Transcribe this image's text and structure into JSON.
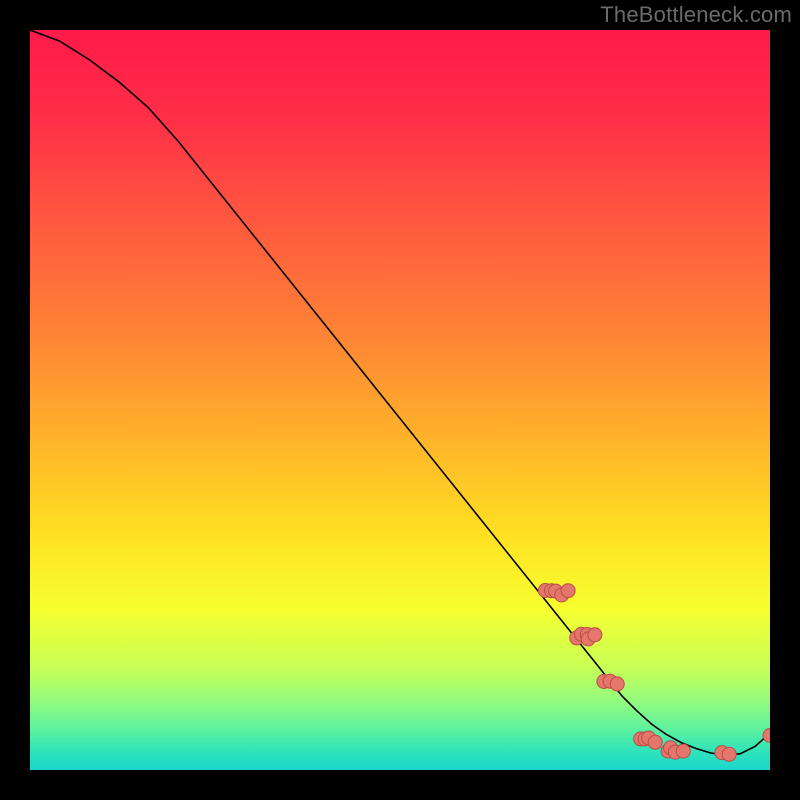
{
  "watermark": "TheBottleneck.com",
  "colors": {
    "line": "#000000",
    "dot_fill": "#e5766b",
    "dot_stroke": "#b84d46",
    "gradient_stops": [
      {
        "offset": 0.0,
        "color": "#ff1a4a"
      },
      {
        "offset": 0.12,
        "color": "#ff2f47"
      },
      {
        "offset": 0.25,
        "color": "#ff5640"
      },
      {
        "offset": 0.4,
        "color": "#ff8036"
      },
      {
        "offset": 0.55,
        "color": "#ffb22a"
      },
      {
        "offset": 0.68,
        "color": "#ffe022"
      },
      {
        "offset": 0.78,
        "color": "#f7ff2e"
      },
      {
        "offset": 0.86,
        "color": "#c9ff55"
      },
      {
        "offset": 0.91,
        "color": "#8ffb80"
      },
      {
        "offset": 0.95,
        "color": "#55efa3"
      },
      {
        "offset": 0.975,
        "color": "#2fe3ba"
      },
      {
        "offset": 1.0,
        "color": "#19d7cb"
      }
    ]
  },
  "chart_data": {
    "type": "line",
    "title": "",
    "xlabel": "",
    "ylabel": "",
    "xlim": [
      0,
      100
    ],
    "ylim": [
      0,
      100
    ],
    "grid": false,
    "series": [
      {
        "name": "curve",
        "x": [
          0,
          4,
          8,
          12,
          16,
          20,
          72,
          76,
          80,
          82,
          84,
          86,
          88,
          90,
          92,
          94,
          96,
          98,
          100
        ],
        "values": [
          100,
          98.5,
          96.0,
          93.0,
          89.5,
          85,
          20,
          15,
          10,
          8,
          6.2,
          4.8,
          3.7,
          2.9,
          2.3,
          2.0,
          2.2,
          3.2,
          5.0
        ]
      }
    ],
    "dot_clusters": [
      {
        "x_center": 71,
        "y_center": 24,
        "count": 5,
        "spread": 3.2
      },
      {
        "x_center": 75,
        "y_center": 18,
        "count": 5,
        "spread": 2.5
      },
      {
        "x_center": 78.5,
        "y_center": 12,
        "count": 3,
        "spread": 1.5
      },
      {
        "x_center": 83.5,
        "y_center": 4.0,
        "count": 4,
        "spread": 2.0
      },
      {
        "x_center": 87,
        "y_center": 2.8,
        "count": 4,
        "spread": 2.0
      },
      {
        "x_center": 94,
        "y_center": 2.0,
        "count": 2,
        "spread": 1.2
      },
      {
        "x_center": 100,
        "y_center": 5.0,
        "count": 1,
        "spread": 0
      }
    ]
  }
}
